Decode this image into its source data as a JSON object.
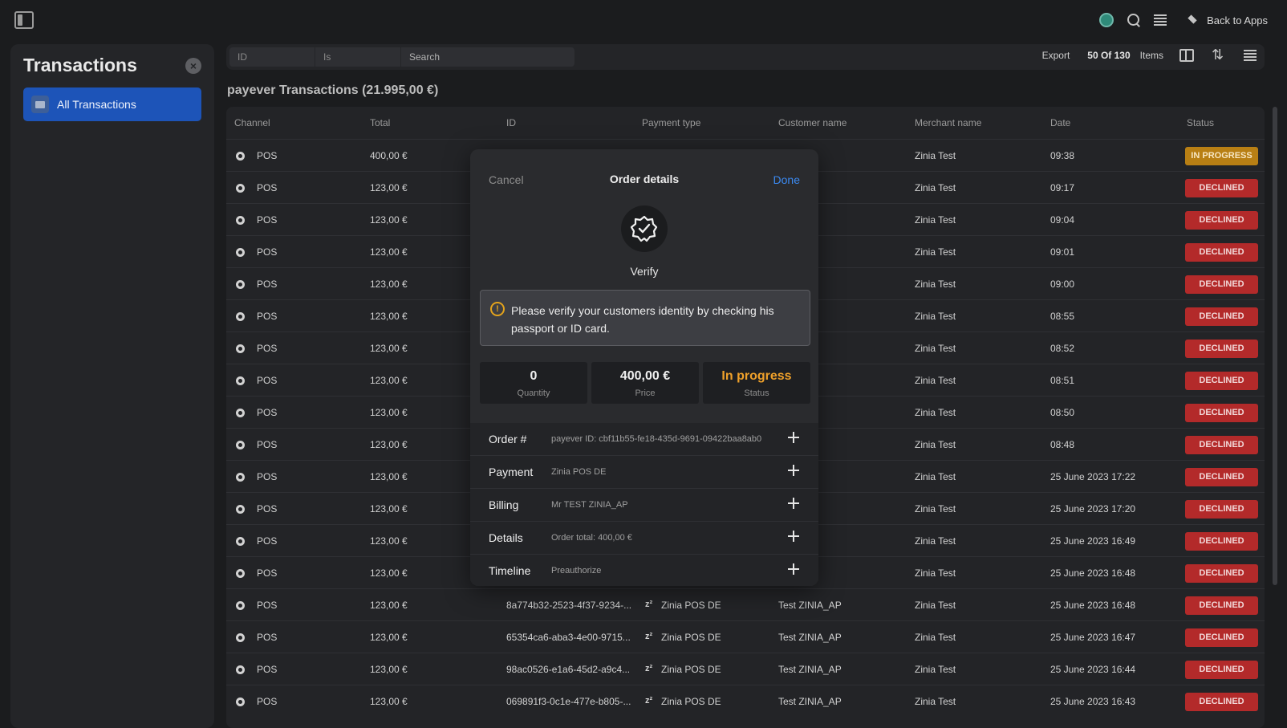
{
  "topbar": {
    "back_label": "Back to Apps",
    "icons": [
      "sidebar-toggle-icon",
      "avatar-icon",
      "search-icon",
      "menu-icon",
      "layers-icon"
    ]
  },
  "sidebar": {
    "title": "Transactions",
    "items": [
      {
        "label": "All Transactions"
      }
    ]
  },
  "filter": {
    "id_placeholder": "ID",
    "is_placeholder": "Is",
    "search_placeholder": "Search",
    "export_label": "Export",
    "count_label": "50 Of 130",
    "items_label": "Items"
  },
  "page_title": "payever Transactions (21.995,00 €)",
  "table": {
    "columns": [
      "Channel",
      "Total",
      "ID",
      "Payment type",
      "Customer name",
      "Merchant name",
      "Date",
      "Status"
    ],
    "rows": [
      {
        "channel": "POS",
        "total": "400,00 €",
        "id": "",
        "payment": "",
        "customer": "IA_AP",
        "merchant": "Zinia Test",
        "date": "09:38",
        "status": "IN PROGRESS"
      },
      {
        "channel": "POS",
        "total": "123,00 €",
        "id": "",
        "payment": "",
        "customer": "IA_AP",
        "merchant": "Zinia Test",
        "date": "09:17",
        "status": "DECLINED"
      },
      {
        "channel": "POS",
        "total": "123,00 €",
        "id": "",
        "payment": "",
        "customer": "IA_AP",
        "merchant": "Zinia Test",
        "date": "09:04",
        "status": "DECLINED"
      },
      {
        "channel": "POS",
        "total": "123,00 €",
        "id": "",
        "payment": "",
        "customer": "IA_AP",
        "merchant": "Zinia Test",
        "date": "09:01",
        "status": "DECLINED"
      },
      {
        "channel": "POS",
        "total": "123,00 €",
        "id": "",
        "payment": "",
        "customer": "IA_AP",
        "merchant": "Zinia Test",
        "date": "09:00",
        "status": "DECLINED"
      },
      {
        "channel": "POS",
        "total": "123,00 €",
        "id": "",
        "payment": "",
        "customer": "IA_AP",
        "merchant": "Zinia Test",
        "date": "08:55",
        "status": "DECLINED"
      },
      {
        "channel": "POS",
        "total": "123,00 €",
        "id": "",
        "payment": "",
        "customer": "IA_AP",
        "merchant": "Zinia Test",
        "date": "08:52",
        "status": "DECLINED"
      },
      {
        "channel": "POS",
        "total": "123,00 €",
        "id": "",
        "payment": "",
        "customer": "IA_AP",
        "merchant": "Zinia Test",
        "date": "08:51",
        "status": "DECLINED"
      },
      {
        "channel": "POS",
        "total": "123,00 €",
        "id": "",
        "payment": "",
        "customer": "IA_AP",
        "merchant": "Zinia Test",
        "date": "08:50",
        "status": "DECLINED"
      },
      {
        "channel": "POS",
        "total": "123,00 €",
        "id": "",
        "payment": "",
        "customer": "IA_AP",
        "merchant": "Zinia Test",
        "date": "08:48",
        "status": "DECLINED"
      },
      {
        "channel": "POS",
        "total": "123,00 €",
        "id": "",
        "payment": "",
        "customer": "IA_AP",
        "merchant": "Zinia Test",
        "date": "25 June 2023 17:22",
        "status": "DECLINED"
      },
      {
        "channel": "POS",
        "total": "123,00 €",
        "id": "",
        "payment": "",
        "customer": "IA_AP",
        "merchant": "Zinia Test",
        "date": "25 June 2023 17:20",
        "status": "DECLINED"
      },
      {
        "channel": "POS",
        "total": "123,00 €",
        "id": "",
        "payment": "",
        "customer": "IA_AP",
        "merchant": "Zinia Test",
        "date": "25 June 2023 16:49",
        "status": "DECLINED"
      },
      {
        "channel": "POS",
        "total": "123,00 €",
        "id": "",
        "payment": "",
        "customer": "IA_AP",
        "merchant": "Zinia Test",
        "date": "25 June 2023 16:48",
        "status": "DECLINED"
      },
      {
        "channel": "POS",
        "total": "123,00 €",
        "id": "8a774b32-2523-4f37-9234-...",
        "payment": "Zinia POS DE",
        "customer": "Test ZINIA_AP",
        "merchant": "Zinia Test",
        "date": "25 June 2023 16:48",
        "status": "DECLINED"
      },
      {
        "channel": "POS",
        "total": "123,00 €",
        "id": "65354ca6-aba3-4e00-9715...",
        "payment": "Zinia POS DE",
        "customer": "Test ZINIA_AP",
        "merchant": "Zinia Test",
        "date": "25 June 2023 16:47",
        "status": "DECLINED"
      },
      {
        "channel": "POS",
        "total": "123,00 €",
        "id": "98ac0526-e1a6-45d2-a9c4...",
        "payment": "Zinia POS DE",
        "customer": "Test ZINIA_AP",
        "merchant": "Zinia Test",
        "date": "25 June 2023 16:44",
        "status": "DECLINED"
      },
      {
        "channel": "POS",
        "total": "123,00 €",
        "id": "069891f3-0c1e-477e-b805-...",
        "payment": "Zinia POS DE",
        "customer": "Test ZINIA_AP",
        "merchant": "Zinia Test",
        "date": "25 June 2023 16:43",
        "status": "DECLINED"
      }
    ]
  },
  "modal": {
    "cancel_label": "Cancel",
    "title": "Order details",
    "done_label": "Done",
    "verify_label": "Verify",
    "alert_text": "Please verify your customers identity by checking his passport or ID card.",
    "stats": [
      {
        "value": "0",
        "label": "Quantity"
      },
      {
        "value": "400,00 €",
        "label": "Price"
      },
      {
        "value": "In progress",
        "label": "Status"
      }
    ],
    "details": [
      {
        "label": "Order #",
        "value": "payever ID: cbf11b55-fe18-435d-9691-09422baa8ab0"
      },
      {
        "label": "Payment",
        "value": "Zinia POS DE"
      },
      {
        "label": "Billing",
        "value": "Mr TEST ZINIA_AP"
      },
      {
        "label": "Details",
        "value": "Order total: 400,00 €"
      },
      {
        "label": "Timeline",
        "value": "Preauthorize"
      }
    ]
  },
  "colors": {
    "accent": "#1d54b8",
    "declined": "#b32a2a",
    "in_progress": "#b87f14",
    "done_link": "#3b8af2"
  }
}
